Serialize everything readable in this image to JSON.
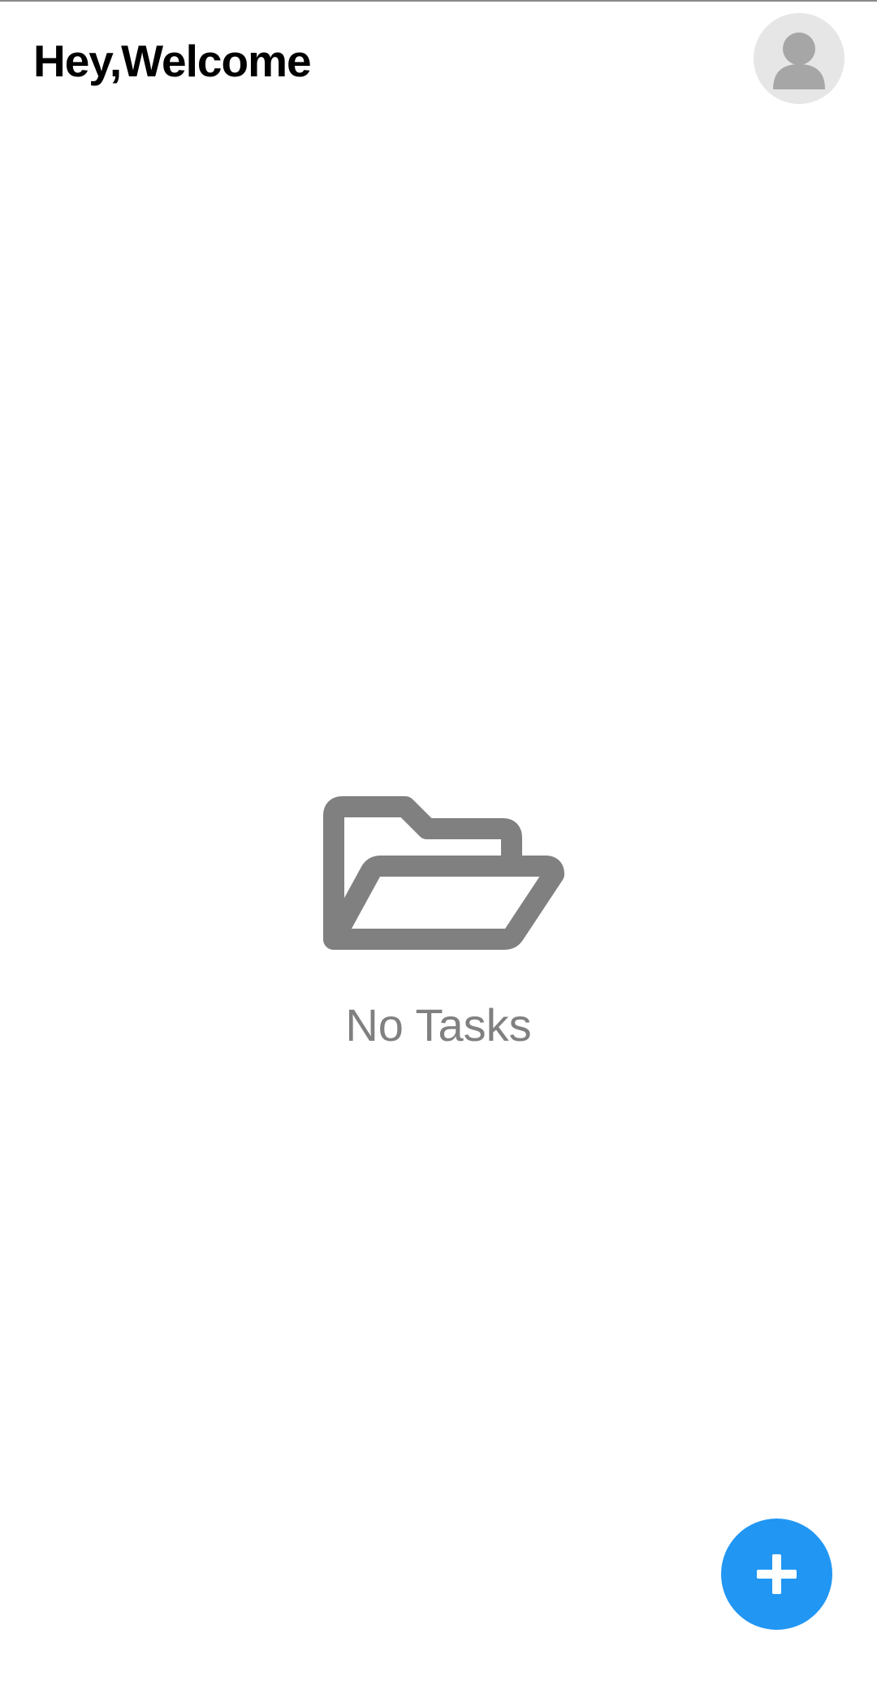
{
  "header": {
    "greeting": "Hey,Welcome",
    "avatar_icon": "user-avatar-icon"
  },
  "empty_state": {
    "icon": "folder-open-icon",
    "message": "No Tasks"
  },
  "fab": {
    "icon": "plus-icon"
  },
  "colors": {
    "background": "#ffffff",
    "greeting_text": "#000000",
    "avatar_bg": "#e6e6e6",
    "avatar_figure": "#a6a6a6",
    "empty_icon": "#808080",
    "empty_text": "#808080",
    "fab_bg": "#2196f3",
    "fab_icon": "#ffffff"
  }
}
